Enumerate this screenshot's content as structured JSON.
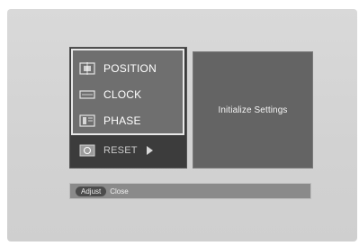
{
  "menu": {
    "items": [
      {
        "label": "POSITION",
        "icon": "position-icon"
      },
      {
        "label": "CLOCK",
        "icon": "clock-icon"
      },
      {
        "label": "PHASE",
        "icon": "phase-icon"
      },
      {
        "label": "RESET",
        "icon": "reset-icon"
      }
    ]
  },
  "info": {
    "text": "Initialize Settings"
  },
  "footer": {
    "adjust_label": "Adjust",
    "close_label": "Close"
  },
  "colors": {
    "background": "#d4d4d4",
    "menu_panel": "#3c3c3c",
    "menu_highlight": "#6f6f6f",
    "info_panel": "#646464",
    "footer_bar": "#8a8a8a"
  }
}
